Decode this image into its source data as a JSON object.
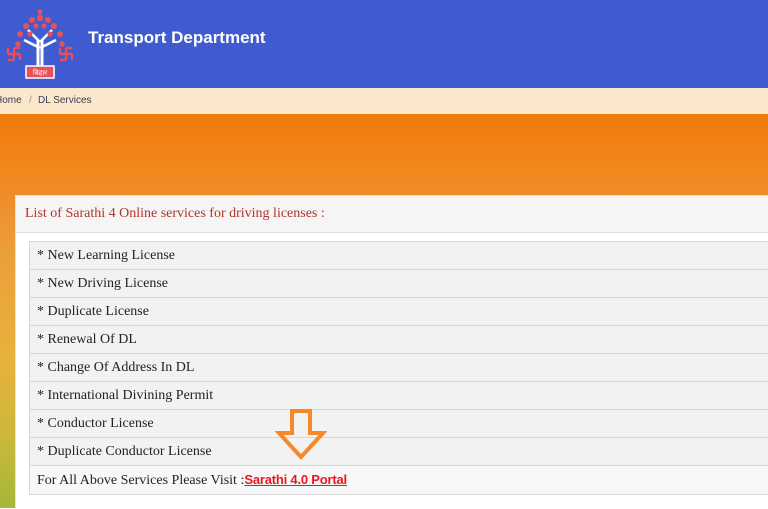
{
  "header": {
    "title": "Transport Department",
    "logo_icon": "bihar-bodhi-tree-emblem-icon",
    "logo_text": "बिहार"
  },
  "breadcrumb": {
    "home": "Home",
    "separator": "/",
    "current": "DL Services"
  },
  "panel": {
    "title": "List of Sarathi 4 Online services for driving licenses :",
    "services": [
      "* New Learning License",
      "* New Driving License",
      "* Duplicate License",
      "* Renewal Of DL",
      "* Change Of Address In DL",
      "* International Divining Permit",
      "* Conductor License",
      "* Duplicate Conductor License"
    ],
    "footer_text": "For All Above Services Please Visit :",
    "portal_link": "Sarathi 4.0 Portal"
  },
  "annotation": {
    "icon": "down-arrow-icon",
    "color": "#f58a2c"
  },
  "colors": {
    "header_bg": "#3f5bcf",
    "breadcrumb_bg": "#fbe8cb",
    "hero_top": "#f07a0c",
    "title_red": "#b0342e",
    "link_red": "#e8191e"
  }
}
